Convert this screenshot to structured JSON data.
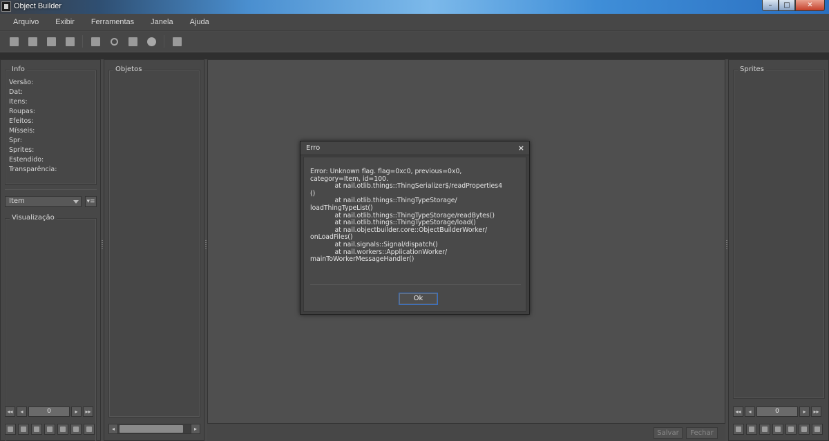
{
  "window": {
    "title": "Object Builder",
    "minimize_glyph": "–",
    "maximize_glyph": "□",
    "close_glyph": "✕"
  },
  "menu": [
    "Arquivo",
    "Exibir",
    "Ferramentas",
    "Janela",
    "Ajuda"
  ],
  "toolbar_icons": [
    "new-file-icon",
    "open-folder-icon",
    "save-icon",
    "save-as-icon",
    "compile-icon",
    "find-icon",
    "sprite-sheet-icon",
    "animation-player-icon",
    "console-icon"
  ],
  "info": {
    "title": "Info",
    "fields": [
      "Versão:",
      "Dat:",
      "Itens:",
      "Roupas:",
      "Efeitos:",
      "Mísseis:",
      "Spr:",
      "Sprites:",
      "Estendido:",
      "Transparência:"
    ]
  },
  "category_select": {
    "value": "Item",
    "filter_glyph": "▾≡"
  },
  "visualization": {
    "title": "Visualização"
  },
  "objects": {
    "title": "Objetos"
  },
  "sprites": {
    "title": "Sprites"
  },
  "pager": {
    "first": "◂◂",
    "prev": "◂",
    "value": "0",
    "next": "▸",
    "last": "▸▸"
  },
  "scroll": {
    "left": "◂",
    "right": "▸"
  },
  "bottom": {
    "save_label": "Salvar",
    "close_label": "Fechar"
  },
  "dialog": {
    "title": "Erro",
    "close_glyph": "×",
    "message": "Error: Unknown flag. flag=0xc0, previous=0x0,\ncategory=Item, id=100.\n            at nail.otlib.things::ThingSerializer$/readProperties4\n()\n            at nail.otlib.things::ThingTypeStorage/\nloadThingTypeList()\n            at nail.otlib.things::ThingTypeStorage/readBytes()\n            at nail.otlib.things::ThingTypeStorage/load()\n            at nail.objectbuilder.core::ObjectBuilderWorker/\nonLoadFiles()\n            at nail.signals::Signal/dispatch()\n            at nail.workers::ApplicationWorker/\nmainToWorkerMessageHandler()",
    "ok_label": "Ok"
  },
  "colors": {
    "panel_bg": "#474747",
    "workspace_bg": "#4f4f4f",
    "focus_border": "#2e6fd0"
  }
}
